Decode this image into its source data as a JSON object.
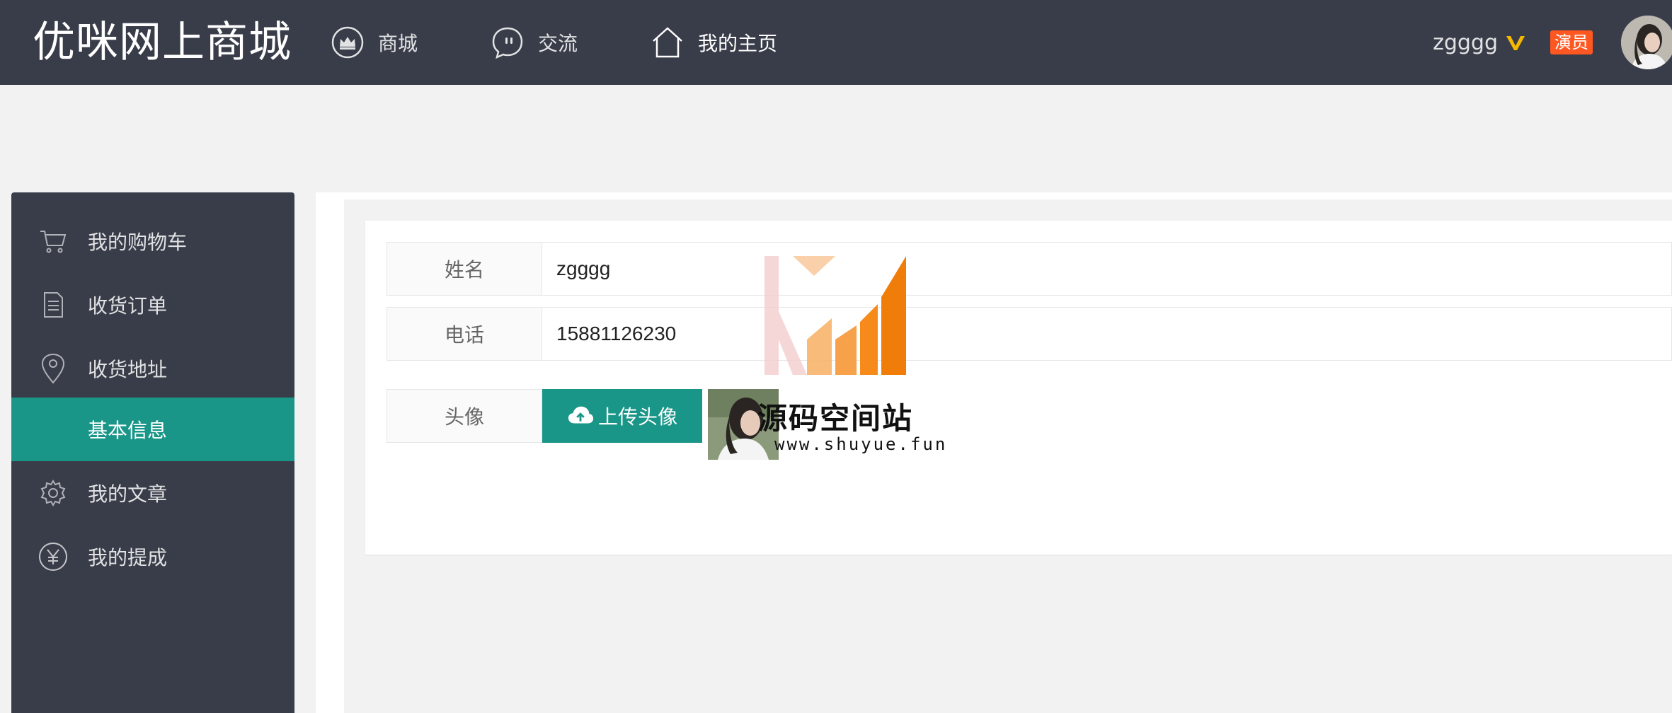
{
  "header": {
    "logo": "优咪网上商城",
    "nav": [
      {
        "label": "商城",
        "icon": "crown-icon"
      },
      {
        "label": "交流",
        "icon": "chat-bubble-icon"
      },
      {
        "label": "我的主页",
        "icon": "home-icon"
      }
    ],
    "user": {
      "name": "zgggg",
      "vip_icon": "vip-v-icon",
      "role": "演员",
      "avatar": "user-avatar"
    }
  },
  "sidebar": {
    "items": [
      {
        "label": "我的购物车",
        "icon": "cart-icon"
      },
      {
        "label": "收货订单",
        "icon": "document-icon"
      },
      {
        "label": "收货地址",
        "icon": "location-pin-icon"
      },
      {
        "label": "基本信息",
        "icon": "",
        "active": true
      },
      {
        "label": "我的文章",
        "icon": "gear-icon"
      },
      {
        "label": "我的提成",
        "icon": "yen-icon"
      }
    ]
  },
  "form": {
    "name_label": "姓名",
    "name_value": "zgggg",
    "phone_label": "电话",
    "phone_value": "15881126230",
    "avatar_label": "头像",
    "upload_button": "上传头像"
  },
  "watermark": {
    "text": "源码空间站",
    "url": "www.shuyue.fun"
  },
  "colors": {
    "header_bg": "#393d49",
    "accent": "#1a9688",
    "badge": "#ff5722",
    "vip": "#f5b800"
  }
}
